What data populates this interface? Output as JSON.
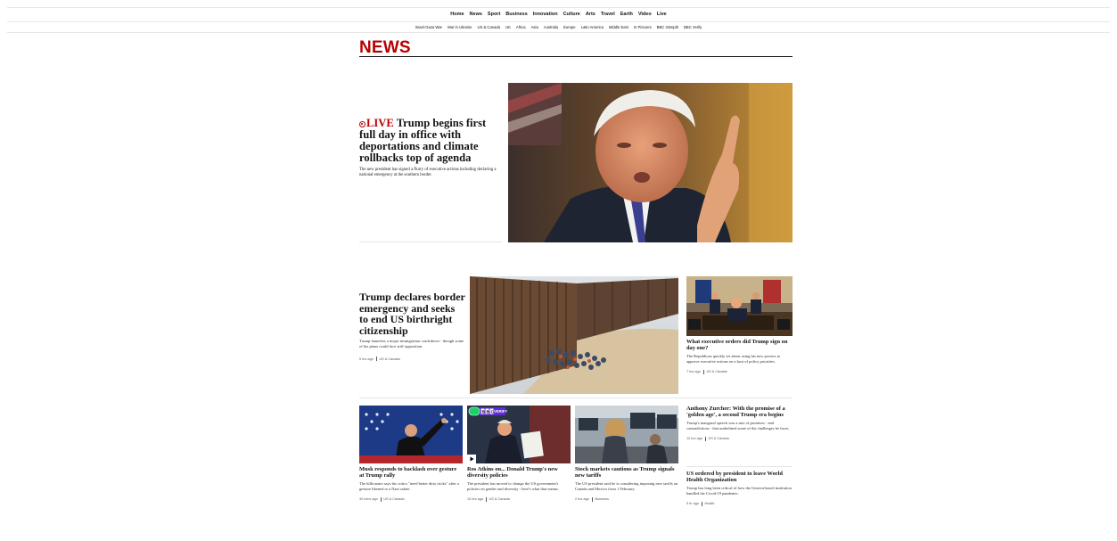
{
  "nav": {
    "primary": [
      "Home",
      "News",
      "Sport",
      "Business",
      "Innovation",
      "Culture",
      "Arts",
      "Travel",
      "Earth",
      "Video",
      "Live"
    ],
    "active": "News",
    "secondary": [
      "Israel-Gaza War",
      "War in Ukraine",
      "US & Canada",
      "UK",
      "Africa",
      "Asia",
      "Australia",
      "Europe",
      "Latin America",
      "Middle East",
      "In Pictures",
      "BBC InDepth",
      "BBC Verify"
    ]
  },
  "brand": {
    "title": "NEWS",
    "color": "#b80000"
  },
  "hero": {
    "live_label": "LIVE",
    "title": "Trump begins first full day in office with deportations and climate rollbacks top of agenda",
    "summary": "The new president has signed a flurry of executive actions including declaring a national emergency at the southern border."
  },
  "lead": {
    "title": "Trump declares border emergency and seeks to end US birthright citizenship",
    "summary": "Trump launches a major immigration crackdown - though some of his plans could face stiff opposition.",
    "time": "5 hrs ago",
    "tag": "US & Canada"
  },
  "side_story": {
    "title": "What executive orders did Trump sign on day one?",
    "summary": "The Republican quickly set about using his new powers to approve executive actions on a host of policy priorities.",
    "time": "7 hrs ago",
    "tag": "US & Canada"
  },
  "bottom": [
    {
      "title": "Musk responds to backlash over gesture at Trump rally",
      "summary": "The billionaire says his critics \"need better dirty tricks\" after a gesture likened to a Nazi salute.",
      "time": "30 mins ago",
      "tag": "US & Canada"
    },
    {
      "title": "Ros Atkins on... Donald Trump's new diversity policies",
      "summary": "The president has moved to change the US government's policies on gender and diversity - here's what that means.",
      "time": "10 hrs ago",
      "tag": "US & Canada",
      "badge": "VERIFY"
    },
    {
      "title": "Stock markets cautious as Trump signals new tariffs",
      "summary": "The US president said he is considering imposing new tariffs on Canada and Mexico from 1 February.",
      "time": "2 hrs ago",
      "tag": "Business"
    }
  ],
  "right_list": [
    {
      "title": "Anthony Zurcher: With the promise of a 'golden age', a second Trump era begins",
      "summary": "Trump's inaugural speech was a mix of promises - and contradictions - that underlined some of the challenges he faces.",
      "time": "12 hrs ago",
      "tag": "US & Canada"
    },
    {
      "title": "US ordered by president to leave World Health Organization",
      "summary": "Trump has long been critical of how the Geneva-based institution handled the Covid-19 pandemic.",
      "time": "5 hr ago",
      "tag": "Health"
    }
  ]
}
